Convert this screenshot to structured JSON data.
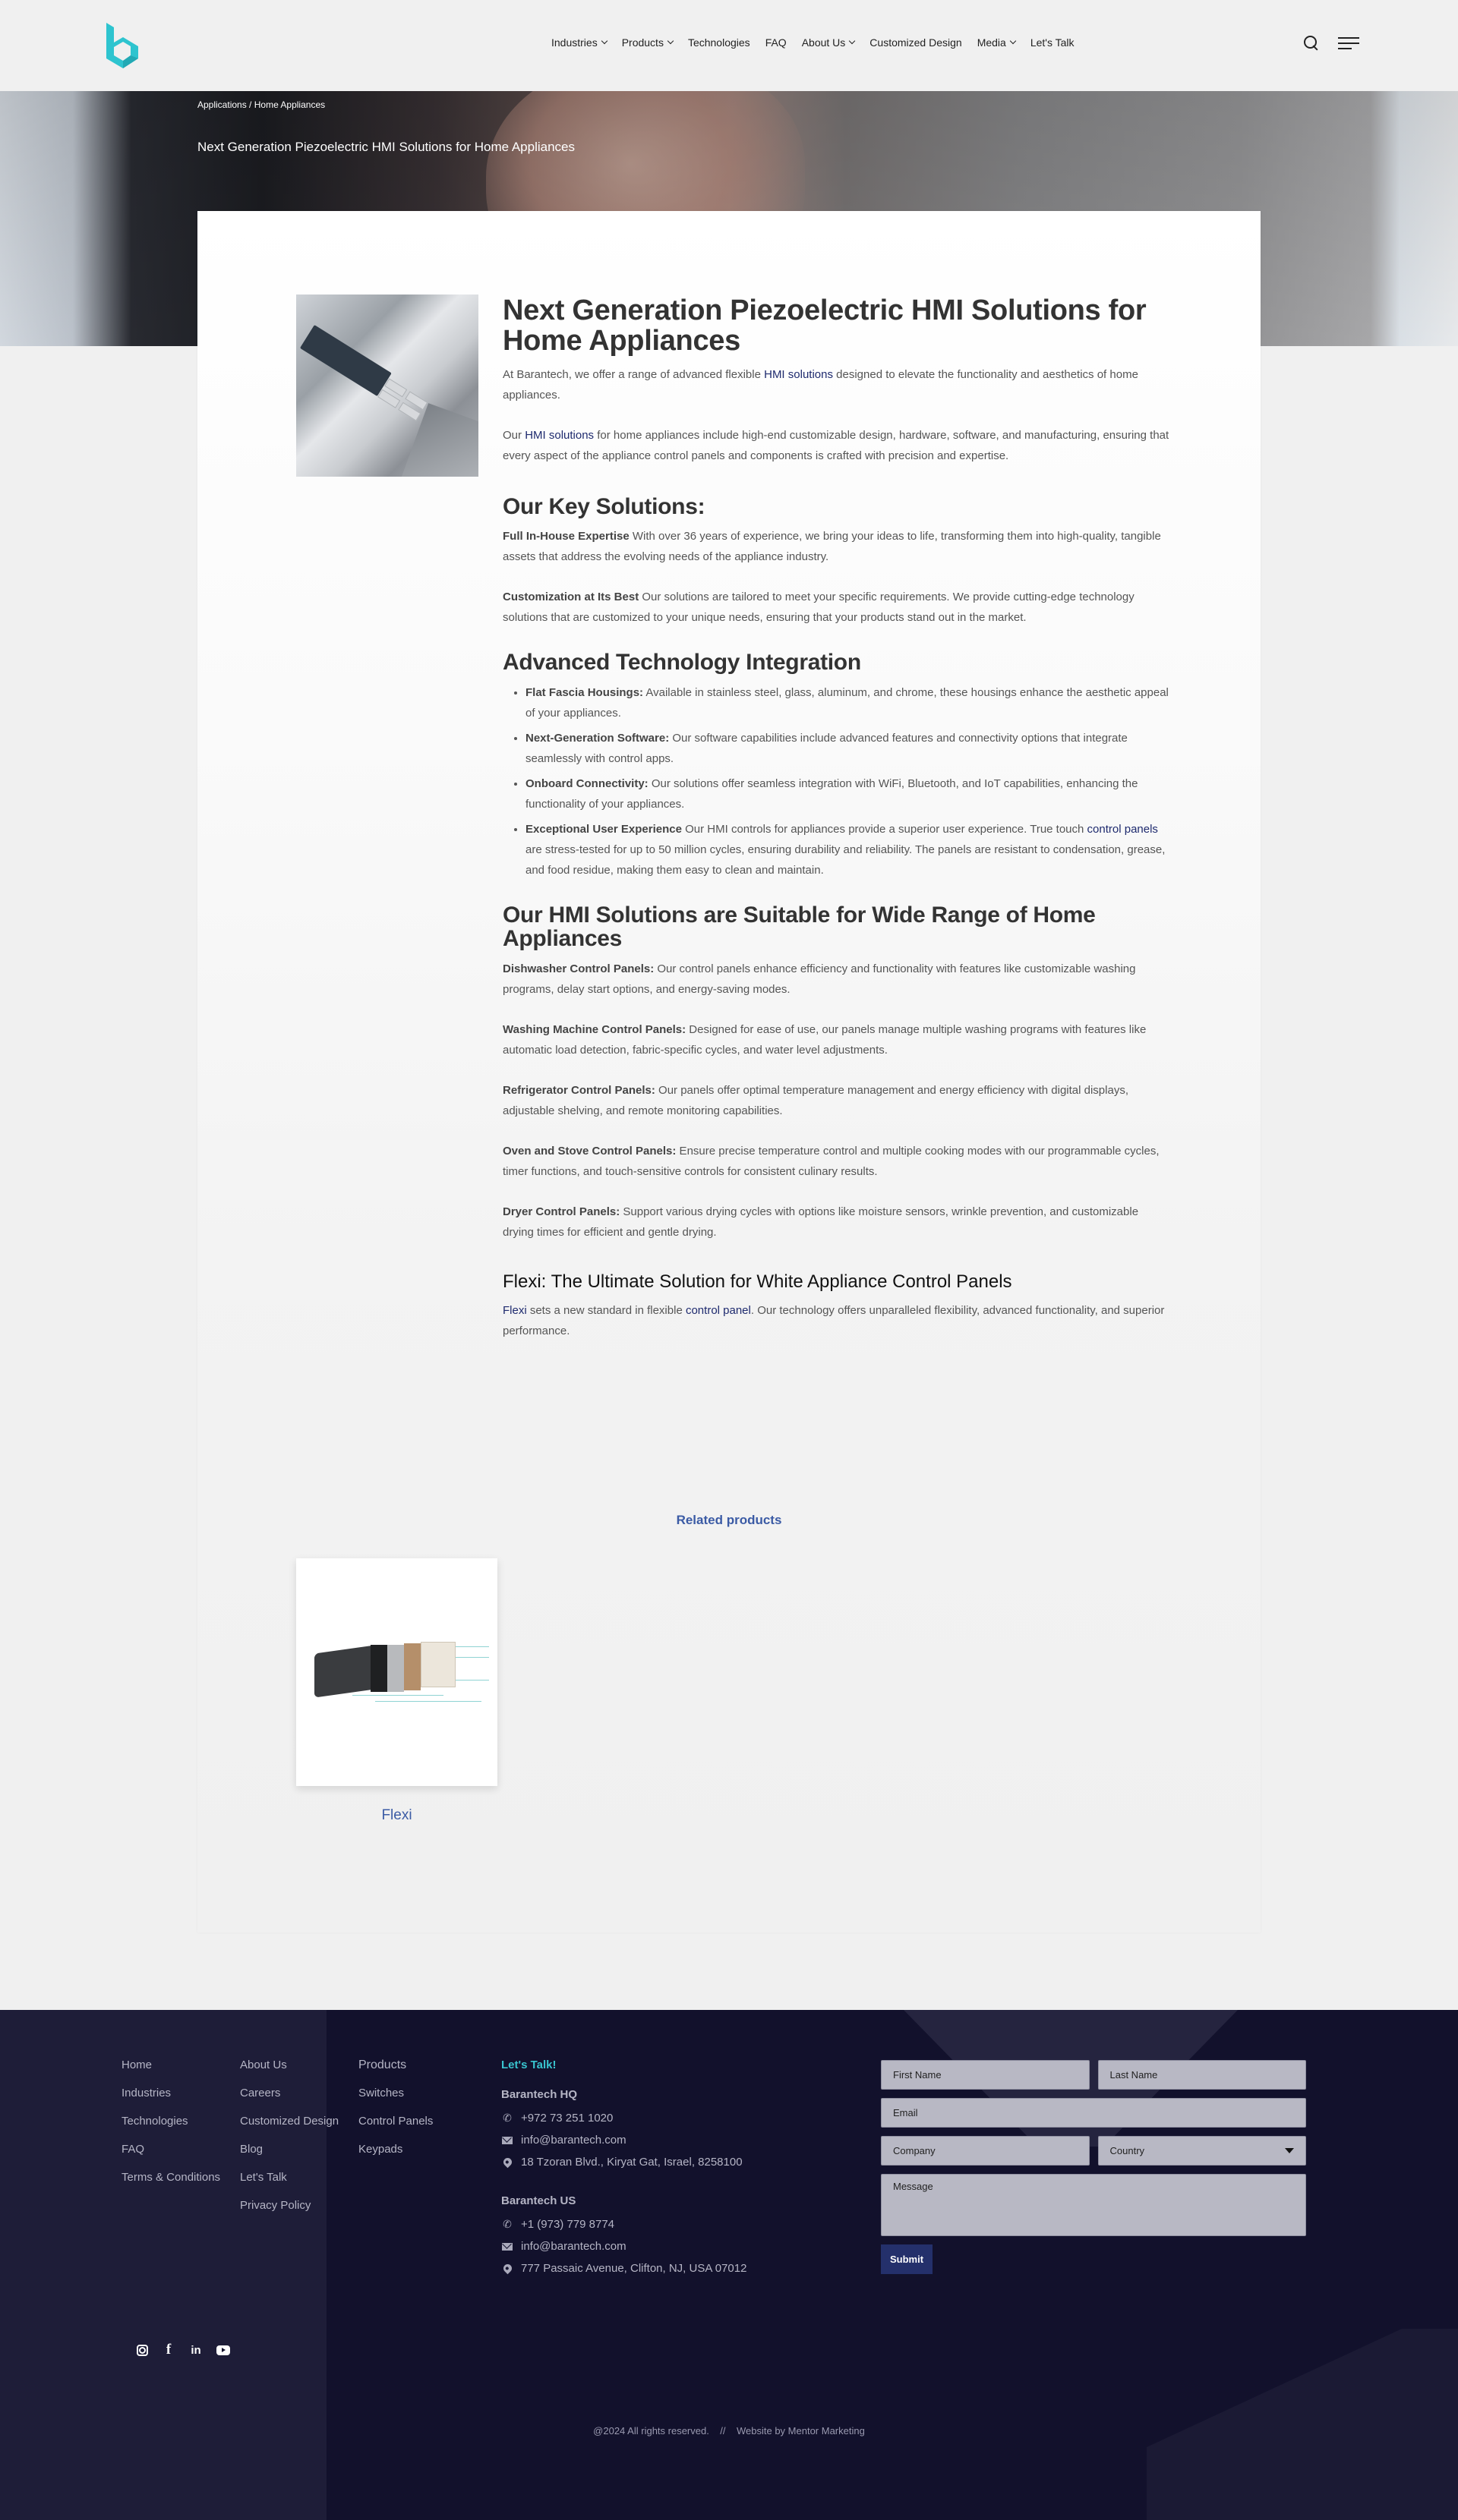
{
  "colors": {
    "brand_teal": "#2ec4cf",
    "link_navy": "#1e2a6e",
    "related_blue": "#3b5ba5",
    "footer_bg": "#12112c",
    "submit_bg": "#24306b",
    "lets_talk": "#39c4cf"
  },
  "header": {
    "logo_icon": "barantech-logo-icon",
    "nav": [
      {
        "label": "Industries",
        "has_dropdown": true
      },
      {
        "label": "Products",
        "has_dropdown": true
      },
      {
        "label": "Technologies",
        "has_dropdown": false
      },
      {
        "label": "FAQ",
        "has_dropdown": false
      },
      {
        "label": "About Us",
        "has_dropdown": true
      },
      {
        "label": "Customized Design",
        "has_dropdown": false
      },
      {
        "label": "Media",
        "has_dropdown": true
      },
      {
        "label": "Let's Talk",
        "has_dropdown": false
      }
    ],
    "icons": [
      "search-icon",
      "menu-icon"
    ]
  },
  "hero": {
    "breadcrumb": {
      "parent": "Applications",
      "separator": " / ",
      "current": "Home Appliances"
    },
    "title": "Next Generation Piezoelectric HMI Solutions for Home Appliances"
  },
  "article": {
    "title": "Next Generation Piezoelectric HMI Solutions for Home Appliances",
    "intro": [
      {
        "before": "At Barantech, we offer a range of advanced flexible ",
        "link": "HMI solutions",
        "after": " designed to elevate the functionality and aesthetics of home appliances."
      },
      {
        "before": "Our ",
        "link": "HMI solutions",
        "after": " for home appliances include high-end customizable design, hardware, software, and manufacturing, ensuring that every aspect of the appliance control panels and components is crafted with precision and expertise."
      }
    ],
    "key_solutions": {
      "heading": "Our Key Solutions:",
      "items": [
        {
          "bold": "Full In-House Expertise",
          "text": " With over 36 years of experience, we bring your ideas to life, transforming them into high-quality, tangible assets that address the evolving needs of the appliance industry."
        },
        {
          "bold": "Customization at Its Best",
          "text": " Our solutions are tailored to meet your specific requirements. We provide cutting-edge technology solutions that are customized to your unique needs, ensuring that your products stand out in the market."
        }
      ]
    },
    "advanced": {
      "heading": "Advanced Technology Integration",
      "items": [
        {
          "bold": "Flat Fascia Housings:",
          "text": " Available in stainless steel, glass, aluminum, and chrome, these housings enhance the aesthetic appeal of your appliances."
        },
        {
          "bold": "Next-Generation Software:",
          "text": " Our software capabilities include advanced features and connectivity options that integrate seamlessly with control apps."
        },
        {
          "bold": "Onboard Connectivity:",
          "text": " Our solutions offer seamless integration with WiFi, Bluetooth, and IoT capabilities, enhancing the functionality of your appliances."
        },
        {
          "bold": "Exceptional User Experience",
          "text": " Our HMI controls for appliances provide a superior user experience. True touch ",
          "link": "control panels",
          "after": " are stress-tested for up to 50 million cycles, ensuring durability and reliability. The panels are resistant to condensation, grease, and food residue, making them easy to clean and maintain."
        }
      ]
    },
    "suitable": {
      "heading": "Our HMI Solutions are Suitable for Wide Range of Home Appliances",
      "items": [
        {
          "bold": "Dishwasher Control Panels:",
          "text": " Our control panels enhance efficiency and functionality with features like customizable washing programs, delay start options, and energy-saving modes."
        },
        {
          "bold": "Washing Machine Control Panels:",
          "text": " Designed for ease of use, our panels manage multiple washing programs with features like automatic load detection, fabric-specific cycles, and water level adjustments."
        },
        {
          "bold": "Refrigerator Control Panels:",
          "text": " Our panels offer optimal temperature management and energy efficiency with digital displays, adjustable shelving, and remote monitoring capabilities."
        },
        {
          "bold": "Oven and Stove Control Panels:",
          "text": " Ensure precise temperature control and multiple cooking modes with our programmable cycles, timer functions, and touch-sensitive controls for consistent culinary results."
        },
        {
          "bold": "Dryer Control Panels:",
          "text": " Support various drying cycles with options like moisture sensors, wrinkle prevention, and customizable drying times for efficient and gentle drying."
        }
      ]
    },
    "flexi": {
      "heading": "Flexi: The Ultimate Solution for White Appliance Control Panels",
      "link1": "Flexi",
      "text1": " sets a new standard in flexible ",
      "link2": "control panel",
      "text2": ". Our technology offers  unparalleled flexibility, advanced functionality, and superior performance."
    }
  },
  "related": {
    "heading": "Related products",
    "products": [
      {
        "name": "Flexi"
      }
    ]
  },
  "footer": {
    "col1": [
      "Home",
      "Industries",
      "Technologies",
      "FAQ",
      "Terms & Conditions"
    ],
    "col2": [
      "About Us",
      "Careers",
      "Customized Design",
      "Blog",
      "Let's Talk",
      "Privacy Policy"
    ],
    "col3": [
      "Products",
      "Switches",
      "Control Panels",
      "Keypads"
    ],
    "contact": {
      "heading": "Let's Talk!",
      "offices": [
        {
          "name": "Barantech HQ",
          "phone": "+972 73 251 1020",
          "email": "info@barantech.com",
          "address": "18 Tzoran Blvd., Kiryat Gat, Israel, 8258100"
        },
        {
          "name": "Barantech US",
          "phone": "+1 (973) 779 8774",
          "email": "info@barantech.com",
          "address": "777 Passaic Avenue, Clifton, NJ, USA 07012"
        }
      ]
    },
    "form": {
      "first_name": "First Name",
      "last_name": "Last Name",
      "email": "Email",
      "company": "Company",
      "country": "Country",
      "message": "Message",
      "submit": "Submit"
    },
    "socials": [
      "instagram-icon",
      "facebook-icon",
      "linkedin-icon",
      "youtube-icon"
    ],
    "copyright": "@2024 All rights reserved.",
    "separator": "//",
    "credit": "Website by Mentor Marketing"
  }
}
